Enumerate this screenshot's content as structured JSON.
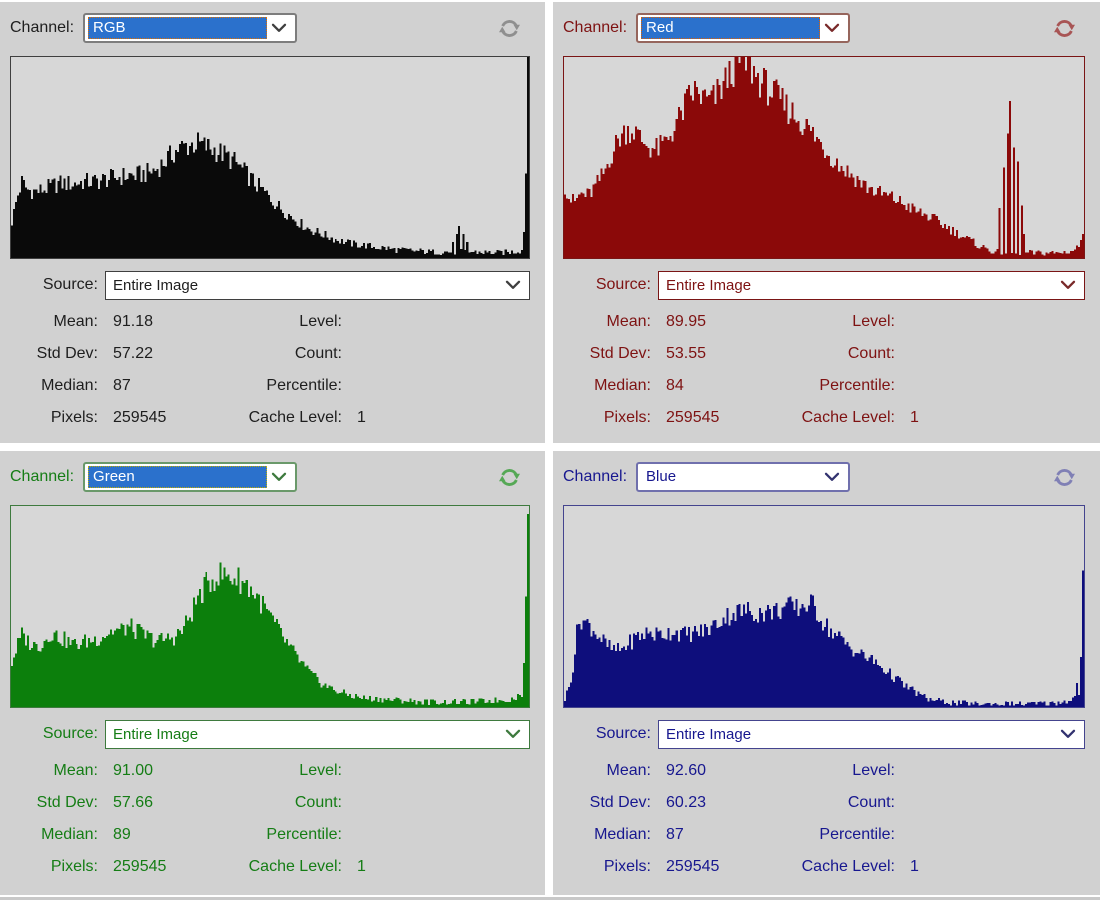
{
  "ui": {
    "background": "#d1d1d1",
    "divider": "#ffffff",
    "select_highlight": "#2b71cc"
  },
  "panels": [
    {
      "channel_label": "Channel:",
      "channel_value": "RGB",
      "channel_highlighted": true,
      "source_label": "Source:",
      "source_value": "Entire Image",
      "stats": {
        "mean_label": "Mean:",
        "mean": "91.18",
        "std_label": "Std Dev:",
        "std": "57.22",
        "median_label": "Median:",
        "median": "87",
        "pixels_label": "Pixels:",
        "pixels": "259545",
        "level_label": "Level:",
        "level": "",
        "count_label": "Count:",
        "count": "",
        "percentile_label": "Percentile:",
        "percentile": "",
        "cache_label": "Cache Level:",
        "cache": "1"
      },
      "colors": {
        "txt": "#1e1e1e",
        "boxb": "#3f3f3f",
        "selb": "#7d7d7d",
        "chev": "#3f3f3f",
        "refresh": "#8f8f8f",
        "focus": "#e07000"
      }
    },
    {
      "channel_label": "Channel:",
      "channel_value": "Red",
      "channel_highlighted": true,
      "source_label": "Source:",
      "source_value": "Entire Image",
      "stats": {
        "mean_label": "Mean:",
        "mean": "89.95",
        "std_label": "Std Dev:",
        "std": "53.55",
        "median_label": "Median:",
        "median": "84",
        "pixels_label": "Pixels:",
        "pixels": "259545",
        "level_label": "Level:",
        "level": "",
        "count_label": "Count:",
        "count": "",
        "percentile_label": "Percentile:",
        "percentile": "",
        "cache_label": "Cache Level:",
        "cache": "1"
      },
      "colors": {
        "txt": "#7e1212",
        "boxb": "#7a1515",
        "selb": "#96655c",
        "chev": "#7a2a2a",
        "refresh": "#a85555",
        "focus": "#e06000"
      }
    },
    {
      "channel_label": "Channel:",
      "channel_value": "Green",
      "channel_highlighted": true,
      "source_label": "Source:",
      "source_value": "Entire Image",
      "stats": {
        "mean_label": "Mean:",
        "mean": "91.00",
        "std_label": "Std Dev:",
        "std": "57.66",
        "median_label": "Median:",
        "median": "89",
        "pixels_label": "Pixels:",
        "pixels": "259545",
        "level_label": "Level:",
        "level": "",
        "count_label": "Count:",
        "count": "",
        "percentile_label": "Percentile:",
        "percentile": "",
        "cache_label": "Cache Level:",
        "cache": "1"
      },
      "colors": {
        "txt": "#157d15",
        "boxb": "#3e7a3e",
        "selb": "#6a996a",
        "chev": "#3e7a3e",
        "refresh": "#55a855",
        "focus": "#bfae00"
      }
    },
    {
      "channel_label": "Channel:",
      "channel_value": "Blue",
      "channel_highlighted": false,
      "source_label": "Source:",
      "source_value": "Entire Image",
      "stats": {
        "mean_label": "Mean:",
        "mean": "92.60",
        "std_label": "Std Dev:",
        "std": "60.23",
        "median_label": "Median:",
        "median": "87",
        "pixels_label": "Pixels:",
        "pixels": "259545",
        "level_label": "Level:",
        "level": "",
        "count_label": "Count:",
        "count": "",
        "percentile_label": "Percentile:",
        "percentile": "",
        "cache_label": "Cache Level:",
        "cache": "1"
      },
      "colors": {
        "txt": "#17178f",
        "boxb": "#44448e",
        "selb": "#7070ad",
        "chev": "#333370",
        "refresh": "#8080b5",
        "focus": "#7070ad"
      }
    }
  ],
  "chart_data": [
    {
      "type": "histogram",
      "channel": "RGB",
      "color": "#0a0a0a",
      "x_range": [
        0,
        255
      ],
      "y_unit": "relative frequency (% of chart height)",
      "mean": 91.18,
      "std_dev": 57.22,
      "median": 87,
      "pixels": 259545,
      "cache_level": 1,
      "envelope": [
        [
          0,
          18
        ],
        [
          0.01,
          30
        ],
        [
          0.02,
          38
        ],
        [
          0.03,
          34
        ],
        [
          0.05,
          33
        ],
        [
          0.07,
          35
        ],
        [
          0.09,
          37
        ],
        [
          0.12,
          37
        ],
        [
          0.14,
          38
        ],
        [
          0.16,
          38
        ],
        [
          0.18,
          39
        ],
        [
          0.2,
          40
        ],
        [
          0.22,
          41
        ],
        [
          0.24,
          41
        ],
        [
          0.26,
          42
        ],
        [
          0.28,
          44
        ],
        [
          0.3,
          49
        ],
        [
          0.32,
          54
        ],
        [
          0.34,
          56
        ],
        [
          0.36,
          57
        ],
        [
          0.38,
          55
        ],
        [
          0.4,
          53
        ],
        [
          0.42,
          50
        ],
        [
          0.44,
          46
        ],
        [
          0.46,
          40
        ],
        [
          0.48,
          35
        ],
        [
          0.5,
          30
        ],
        [
          0.52,
          25
        ],
        [
          0.54,
          21
        ],
        [
          0.56,
          17
        ],
        [
          0.58,
          14
        ],
        [
          0.6,
          12
        ],
        [
          0.63,
          9
        ],
        [
          0.66,
          7
        ],
        [
          0.69,
          6
        ],
        [
          0.72,
          5
        ],
        [
          0.75,
          4
        ],
        [
          0.78,
          3.5
        ],
        [
          0.81,
          3
        ],
        [
          0.85,
          3
        ],
        [
          0.9,
          3
        ],
        [
          0.94,
          2.5
        ],
        [
          0.97,
          3
        ],
        [
          0.99,
          4
        ],
        [
          1,
          6
        ]
      ],
      "spikes": [
        [
          0.855,
          8
        ],
        [
          0.862,
          12
        ],
        [
          0.868,
          16
        ],
        [
          0.874,
          12
        ],
        [
          0.881,
          8
        ],
        [
          0.993,
          13
        ],
        [
          0.997,
          42
        ],
        [
          1,
          100
        ]
      ]
    },
    {
      "type": "histogram",
      "channel": "Red",
      "color": "#8b0909",
      "x_range": [
        0,
        255
      ],
      "y_unit": "relative frequency (% of chart height)",
      "mean": 89.95,
      "std_dev": 53.55,
      "median": 84,
      "pixels": 259545,
      "cache_level": 1,
      "envelope": [
        [
          0,
          36
        ],
        [
          0.01,
          29
        ],
        [
          0.02,
          28
        ],
        [
          0.03,
          32
        ],
        [
          0.045,
          31
        ],
        [
          0.06,
          36
        ],
        [
          0.075,
          42
        ],
        [
          0.09,
          52
        ],
        [
          0.105,
          60
        ],
        [
          0.12,
          64
        ],
        [
          0.135,
          63
        ],
        [
          0.15,
          58
        ],
        [
          0.165,
          55
        ],
        [
          0.18,
          54
        ],
        [
          0.195,
          58
        ],
        [
          0.21,
          64
        ],
        [
          0.225,
          72
        ],
        [
          0.24,
          80
        ],
        [
          0.25,
          83
        ],
        [
          0.26,
          81
        ],
        [
          0.27,
          79
        ],
        [
          0.28,
          78
        ],
        [
          0.29,
          80
        ],
        [
          0.3,
          84
        ],
        [
          0.315,
          90
        ],
        [
          0.33,
          96
        ],
        [
          0.345,
          98
        ],
        [
          0.36,
          94
        ],
        [
          0.375,
          89
        ],
        [
          0.39,
          85
        ],
        [
          0.405,
          81
        ],
        [
          0.42,
          77
        ],
        [
          0.44,
          72
        ],
        [
          0.46,
          67
        ],
        [
          0.48,
          61
        ],
        [
          0.5,
          55
        ],
        [
          0.52,
          49
        ],
        [
          0.54,
          44
        ],
        [
          0.56,
          40
        ],
        [
          0.58,
          36
        ],
        [
          0.6,
          33
        ],
        [
          0.62,
          31
        ],
        [
          0.64,
          29
        ],
        [
          0.66,
          26
        ],
        [
          0.68,
          23
        ],
        [
          0.7,
          21
        ],
        [
          0.72,
          18
        ],
        [
          0.74,
          15
        ],
        [
          0.76,
          12
        ],
        [
          0.78,
          9
        ],
        [
          0.8,
          6
        ],
        [
          0.82,
          4
        ],
        [
          0.83,
          3
        ],
        [
          0.9,
          2.5
        ],
        [
          0.95,
          2.5
        ],
        [
          0.98,
          3.5
        ],
        [
          1,
          8
        ]
      ],
      "spikes": [
        [
          0.838,
          25
        ],
        [
          0.846,
          45
        ],
        [
          0.853,
          62
        ],
        [
          0.86,
          78
        ],
        [
          0.867,
          55
        ],
        [
          0.874,
          48
        ],
        [
          0.881,
          26
        ],
        [
          0.888,
          12
        ],
        [
          1,
          12
        ]
      ]
    },
    {
      "type": "histogram",
      "channel": "Green",
      "color": "#0c7f0c",
      "x_range": [
        0,
        255
      ],
      "y_unit": "relative frequency (% of chart height)",
      "mean": 91.0,
      "std_dev": 57.66,
      "median": 89,
      "pixels": 259545,
      "cache_level": 1,
      "envelope": [
        [
          0,
          22
        ],
        [
          0.01,
          30
        ],
        [
          0.02,
          36
        ],
        [
          0.03,
          33
        ],
        [
          0.045,
          30
        ],
        [
          0.06,
          32
        ],
        [
          0.075,
          37
        ],
        [
          0.09,
          35
        ],
        [
          0.105,
          33
        ],
        [
          0.12,
          31
        ],
        [
          0.135,
          32
        ],
        [
          0.15,
          33
        ],
        [
          0.165,
          34
        ],
        [
          0.18,
          36
        ],
        [
          0.195,
          38
        ],
        [
          0.21,
          38
        ],
        [
          0.225,
          40
        ],
        [
          0.24,
          38
        ],
        [
          0.255,
          36
        ],
        [
          0.27,
          34
        ],
        [
          0.285,
          33
        ],
        [
          0.3,
          34
        ],
        [
          0.315,
          35
        ],
        [
          0.33,
          38
        ],
        [
          0.345,
          45
        ],
        [
          0.36,
          54
        ],
        [
          0.375,
          60
        ],
        [
          0.39,
          64
        ],
        [
          0.405,
          66
        ],
        [
          0.42,
          65
        ],
        [
          0.435,
          64
        ],
        [
          0.45,
          62
        ],
        [
          0.465,
          58
        ],
        [
          0.48,
          53
        ],
        [
          0.495,
          47
        ],
        [
          0.51,
          41
        ],
        [
          0.525,
          35
        ],
        [
          0.54,
          29
        ],
        [
          0.555,
          24
        ],
        [
          0.57,
          19
        ],
        [
          0.585,
          15
        ],
        [
          0.6,
          12
        ],
        [
          0.62,
          9
        ],
        [
          0.64,
          7
        ],
        [
          0.66,
          5.5
        ],
        [
          0.68,
          4.5
        ],
        [
          0.71,
          4
        ],
        [
          0.74,
          3.5
        ],
        [
          0.77,
          3
        ],
        [
          0.8,
          2.5
        ],
        [
          0.84,
          2.5
        ],
        [
          0.88,
          2.5
        ],
        [
          0.92,
          3
        ],
        [
          0.95,
          3.5
        ],
        [
          0.97,
          4
        ],
        [
          0.985,
          6
        ],
        [
          1,
          10
        ]
      ],
      "spikes": [
        [
          0.993,
          22
        ],
        [
          0.997,
          55
        ],
        [
          1,
          96
        ]
      ]
    },
    {
      "type": "histogram",
      "channel": "Blue",
      "color": "#0e0e7c",
      "x_range": [
        0,
        255
      ],
      "y_unit": "relative frequency (% of chart height)",
      "mean": 92.6,
      "std_dev": 60.23,
      "median": 87,
      "pixels": 259545,
      "cache_level": 1,
      "envelope": [
        [
          0,
          4
        ],
        [
          0.008,
          10
        ],
        [
          0.016,
          20
        ],
        [
          0.025,
          40
        ],
        [
          0.03,
          44
        ],
        [
          0.04,
          42
        ],
        [
          0.05,
          40
        ],
        [
          0.06,
          37
        ],
        [
          0.07,
          34
        ],
        [
          0.08,
          31
        ],
        [
          0.09,
          29
        ],
        [
          0.1,
          28
        ],
        [
          0.11,
          29
        ],
        [
          0.12,
          31
        ],
        [
          0.13,
          33
        ],
        [
          0.14,
          35
        ],
        [
          0.16,
          37
        ],
        [
          0.18,
          36
        ],
        [
          0.2,
          37
        ],
        [
          0.21,
          38
        ],
        [
          0.23,
          36
        ],
        [
          0.25,
          37
        ],
        [
          0.27,
          38
        ],
        [
          0.29,
          41
        ],
        [
          0.31,
          45
        ],
        [
          0.33,
          47
        ],
        [
          0.35,
          48
        ],
        [
          0.37,
          47
        ],
        [
          0.39,
          47
        ],
        [
          0.41,
          48
        ],
        [
          0.43,
          50
        ],
        [
          0.45,
          49
        ],
        [
          0.47,
          52
        ],
        [
          0.48,
          50
        ],
        [
          0.5,
          42
        ],
        [
          0.52,
          36
        ],
        [
          0.54,
          32
        ],
        [
          0.56,
          28
        ],
        [
          0.58,
          25
        ],
        [
          0.6,
          22
        ],
        [
          0.62,
          18
        ],
        [
          0.64,
          14
        ],
        [
          0.66,
          10
        ],
        [
          0.68,
          7
        ],
        [
          0.7,
          4
        ],
        [
          0.72,
          3
        ],
        [
          0.75,
          2
        ],
        [
          0.8,
          1.5
        ],
        [
          0.85,
          1.5
        ],
        [
          0.9,
          1.5
        ],
        [
          0.95,
          2
        ],
        [
          0.97,
          3
        ],
        [
          0.985,
          5
        ],
        [
          1,
          10
        ]
      ],
      "spikes": [
        [
          0.99,
          12
        ],
        [
          0.995,
          25
        ],
        [
          1,
          68
        ]
      ]
    }
  ]
}
